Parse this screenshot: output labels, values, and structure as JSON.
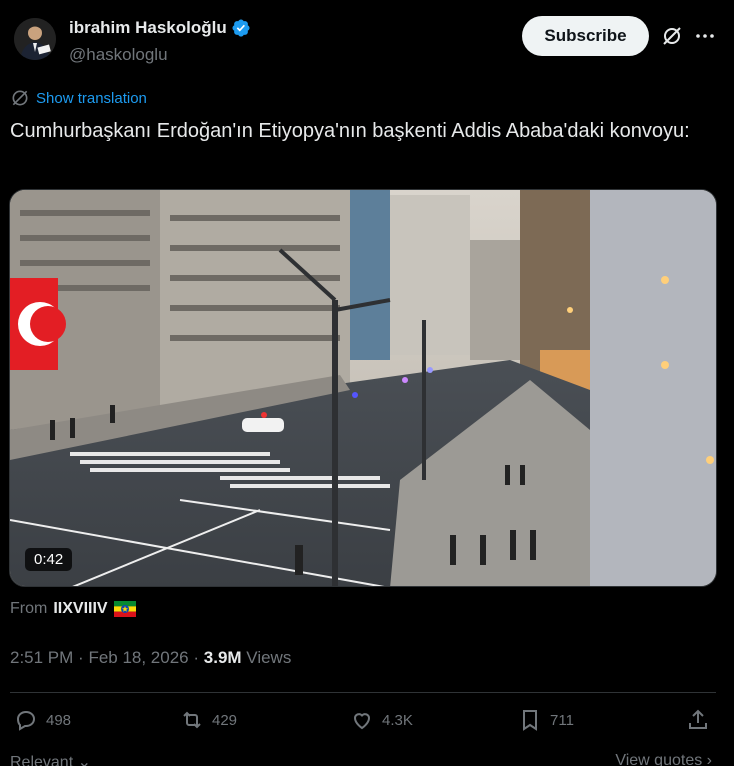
{
  "author": {
    "display_name": "ibrahim Haskoloğlu",
    "handle": "@haskologlu",
    "verified_icon": "verified-badge-icon"
  },
  "header": {
    "subscribe_label": "Subscribe",
    "grok_icon": "grok-icon",
    "more_icon": "more-icon"
  },
  "translation": {
    "label": "Show translation"
  },
  "tweet": {
    "text": "Cumhurbaşkanı Erdoğan'ın Etiyopya'nın başkenti Addis Ababa'daki konvoyu:"
  },
  "video": {
    "duration": "0:42"
  },
  "source": {
    "prefix": "From",
    "user": "IIXVIIIV"
  },
  "meta": {
    "time": "2:51 PM",
    "date": "Feb 18, 2026",
    "views_count": "3.9M",
    "views_label": "Views"
  },
  "actions": {
    "replies": "498",
    "reposts": "429",
    "likes": "4.3K",
    "bookmarks": "711"
  },
  "footer": {
    "relevant_label": "Relevant",
    "view_quotes_label": "View quotes"
  },
  "colors": {
    "background": "#000000",
    "accent": "#1d9bf0",
    "text_primary": "#e7e9ea",
    "text_secondary": "#71767b",
    "border": "#2f3336"
  }
}
